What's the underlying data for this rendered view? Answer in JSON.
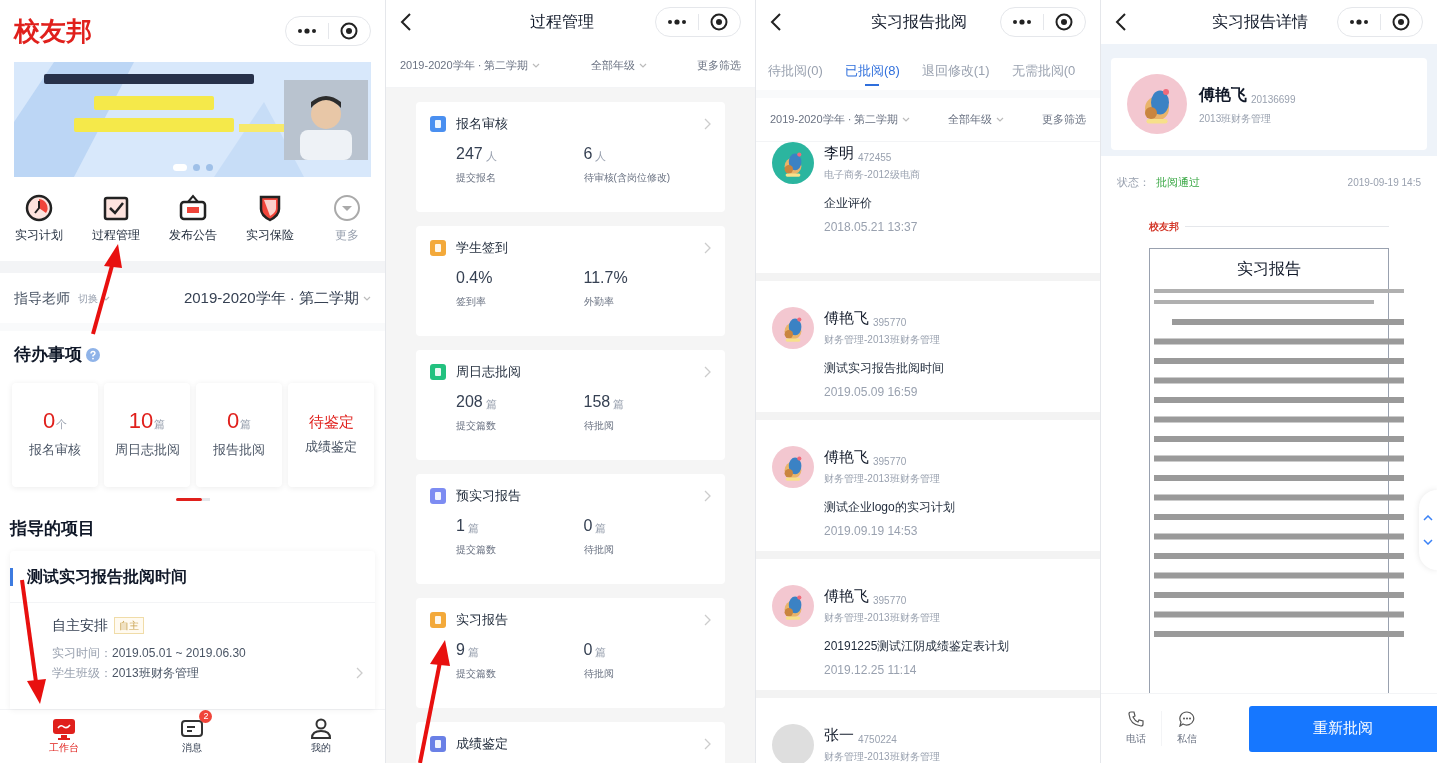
{
  "home": {
    "app_title": "校友邦",
    "banner_dots": [
      {
        "selected": true
      },
      {
        "selected": false
      },
      {
        "selected": false
      }
    ],
    "shortcuts": [
      {
        "label": "实习计划",
        "muted": false
      },
      {
        "label": "过程管理",
        "muted": false
      },
      {
        "label": "发布公告",
        "muted": false
      },
      {
        "label": "实习保险",
        "muted": false
      },
      {
        "label": "更多",
        "muted": true
      }
    ],
    "role": "指导老师",
    "switch": "切换",
    "term": "2019-2020学年 · 第二学期",
    "todo_title": "待办事项",
    "todo_cards": [
      {
        "kind": "count",
        "value": "0",
        "unit": "个",
        "label": "报名审核"
      },
      {
        "kind": "count",
        "value": "10",
        "unit": "篇",
        "label": "周日志批阅"
      },
      {
        "kind": "count",
        "value": "0",
        "unit": "篇",
        "label": "报告批阅"
      },
      {
        "kind": "status",
        "value": "待鉴定",
        "label": "成绩鉴定"
      }
    ],
    "projects_title": "指导的项目",
    "project": {
      "title": "测试实习报告批阅时间",
      "arrangement": "自主安排",
      "tag": "自主",
      "period_label": "实习时间：",
      "period": "2019.05.01 ~ 2019.06.30",
      "class_label": "学生班级：",
      "class": "2013班财务管理"
    },
    "tabbar": [
      {
        "label": "工作台",
        "selected": true
      },
      {
        "label": "消息",
        "selected": false,
        "badge": "2"
      },
      {
        "label": "我的",
        "selected": false
      }
    ]
  },
  "process": {
    "title": "过程管理",
    "filters": [
      {
        "label": "2019-2020学年 · 第二学期",
        "dropdown": true
      },
      {
        "label": "全部年级",
        "dropdown": true
      },
      {
        "label": "更多筛选",
        "dropdown": false
      }
    ],
    "cards": [
      {
        "title": "报名审核",
        "color": "#4a8ff0",
        "stats": [
          {
            "value": "247",
            "unit": "人",
            "label": "提交报名"
          },
          {
            "value": "6",
            "unit": "人",
            "label": "待审核(含岗位修改)"
          }
        ]
      },
      {
        "title": "学生签到",
        "color": "#f3a93a",
        "stats": [
          {
            "value": "0.4%",
            "label": "签到率"
          },
          {
            "value": "11.7%",
            "label": "外勤率"
          }
        ]
      },
      {
        "title": "周日志批阅",
        "color": "#22c17f",
        "stats": [
          {
            "value": "208",
            "unit": "篇",
            "label": "提交篇数"
          },
          {
            "value": "158",
            "unit": "篇",
            "label": "待批阅"
          }
        ]
      },
      {
        "title": "预实习报告",
        "color": "#7d8cf2",
        "stats": [
          {
            "value": "1",
            "unit": "篇",
            "label": "提交篇数"
          },
          {
            "value": "0",
            "unit": "篇",
            "label": "待批阅"
          }
        ]
      },
      {
        "title": "实习报告",
        "color": "#f3a93a",
        "stats": [
          {
            "value": "9",
            "unit": "篇",
            "label": "提交篇数"
          },
          {
            "value": "0",
            "unit": "篇",
            "label": "待批阅"
          }
        ]
      },
      {
        "title": "成绩鉴定",
        "color": "#6a80e6"
      }
    ]
  },
  "review": {
    "title": "实习报告批阅",
    "tabs": [
      {
        "label": "待批阅(0)",
        "selected": false
      },
      {
        "label": "已批阅(8)",
        "selected": true
      },
      {
        "label": "退回修改(1)",
        "selected": false
      },
      {
        "label": "无需批阅(0",
        "selected": false
      }
    ],
    "filters": [
      {
        "label": "2019-2020学年 · 第二学期",
        "dropdown": true
      },
      {
        "label": "全部年级",
        "dropdown": true
      },
      {
        "label": "更多筛选",
        "dropdown": false
      }
    ],
    "items": [
      {
        "name": "李明",
        "id": "472455",
        "dept": "电子商务-2012级电商",
        "report": "企业评价",
        "time": "2018.05.21 13:37"
      },
      {
        "name": "傅艳飞",
        "id": "395770",
        "dept": "财务管理-2013班财务管理",
        "report": "测试实习报告批阅时间",
        "time": "2019.05.09 16:59"
      },
      {
        "name": "傅艳飞",
        "id": "395770",
        "dept": "财务管理-2013班财务管理",
        "report": "测试企业logo的实习计划",
        "time": "2019.09.19 14:53"
      },
      {
        "name": "傅艳飞",
        "id": "395770",
        "dept": "财务管理-2013班财务管理",
        "report": "20191225测试江阴成绩鉴定表计划",
        "time": "2019.12.25 11:14"
      },
      {
        "name": "张一",
        "id": "4750224",
        "dept": "财务管理-2013班财务管理"
      }
    ]
  },
  "detail": {
    "title": "实习报告详情",
    "name": "傅艳飞",
    "id": "20136699",
    "class": "2013班财务管理",
    "status_label": "状态：",
    "status": "批阅通过",
    "time": "2019-09-19 14:5",
    "doc_logo": "校友邦",
    "doc_title": "实习报告",
    "actions": [
      {
        "label": "电话"
      },
      {
        "label": "私信"
      }
    ],
    "primary_button": "重新批阅"
  }
}
